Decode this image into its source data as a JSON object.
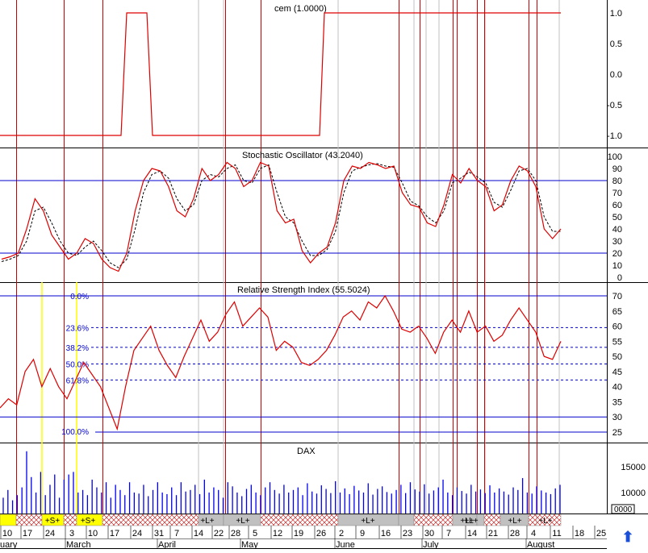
{
  "colors": {
    "price_line": "#dd0000",
    "signal_dashed": "#000000",
    "level_line": "#0000cc",
    "fib_line": "#0000cc",
    "event_vline": "#cc0000",
    "grid_vline": "#c0c0c0",
    "volume_bar": "#0000ee",
    "band_red": "#cc0000",
    "band_gray": "#c0c0c0",
    "band_yellow": "#ffff00",
    "arrow": "#1a4fd6"
  },
  "panels": {
    "cem": {
      "title": "cem (1.0000)",
      "y_ticks": [
        "1.0",
        "0.5",
        "0.0",
        "-0.5",
        "-1.0"
      ]
    },
    "stoch": {
      "title": "Stochastic Oscillator (43.2040)",
      "y_ticks": [
        "100",
        "90",
        "80",
        "70",
        "60",
        "50",
        "40",
        "30",
        "20",
        "10",
        "0"
      ]
    },
    "rsi": {
      "title": "Relative Strength Index (55.5024)",
      "y_ticks": [
        "70",
        "65",
        "60",
        "55",
        "50",
        "45",
        "40",
        "35",
        "30",
        "25"
      ],
      "fib_labels": [
        "0.0%",
        "23.6%",
        "38.2%",
        "50.0%",
        "61.8%",
        "100.0%"
      ]
    },
    "dax": {
      "title": "DAX",
      "y_ticks": [
        "15000",
        "10000"
      ],
      "mini_label": "0000"
    }
  },
  "band": {
    "labels": [
      "+S+",
      "+S+",
      "+L+",
      "+L+",
      "+L+",
      "+L+",
      "+L+",
      "+L+",
      "+L+"
    ]
  },
  "date_axis": {
    "day_labels": [
      "10",
      "17",
      "24",
      "3",
      "10",
      "17",
      "24",
      "31",
      "7",
      "14",
      "22",
      "28",
      "5",
      "12",
      "19",
      "26",
      "2",
      "9",
      "16",
      "23",
      "30",
      "7",
      "14",
      "21",
      "28",
      "4",
      "11",
      "18",
      "25"
    ],
    "month_labels": [
      "uary",
      "March",
      "April",
      "May",
      "June",
      "July",
      "August"
    ]
  },
  "chart_data": [
    {
      "type": "line",
      "title": "cem (1.0000)",
      "ylim": [
        -1.0,
        1.0
      ],
      "x": [
        0,
        1,
        2,
        3,
        4,
        5,
        6,
        7,
        8,
        9,
        10,
        11,
        12,
        13,
        14,
        15,
        16,
        17,
        18,
        19,
        20,
        21,
        22,
        23,
        24,
        25,
        26,
        27
      ],
      "series": [
        {
          "values": [
            -1,
            -1,
            -1,
            -1,
            -1,
            -1,
            -1,
            -1,
            1,
            1,
            -1,
            -1,
            -1,
            -1,
            -1,
            -1,
            -1,
            -1,
            -1,
            -1,
            -1,
            -1,
            1,
            1,
            1,
            1,
            1,
            1
          ]
        }
      ]
    },
    {
      "type": "line",
      "title": "Stochastic Oscillator (43.2040)",
      "ylim": [
        0,
        100
      ],
      "series": [
        {
          "values": [
            15,
            17,
            20,
            40,
            65,
            55,
            35,
            25,
            15,
            20,
            32,
            28,
            15,
            8,
            5,
            20,
            55,
            80,
            90,
            88,
            75,
            55,
            50,
            65,
            90,
            80,
            85,
            95,
            90,
            75,
            80,
            95,
            92,
            55,
            45,
            48,
            22,
            12,
            20,
            25,
            45,
            80,
            92,
            90,
            95,
            93,
            90,
            92,
            70,
            60,
            58,
            45,
            42,
            60,
            85,
            78,
            90,
            80,
            75,
            55,
            60,
            80,
            92,
            88,
            75,
            40,
            32,
            40
          ]
        },
        {
          "values": [
            13,
            15,
            18,
            30,
            55,
            58,
            45,
            30,
            20,
            18,
            25,
            30,
            22,
            12,
            8,
            15,
            40,
            70,
            85,
            88,
            82,
            65,
            55,
            60,
            80,
            85,
            83,
            90,
            93,
            80,
            78,
            90,
            93,
            70,
            50,
            45,
            30,
            18,
            18,
            23,
            38,
            70,
            88,
            91,
            93,
            94,
            92,
            91,
            78,
            63,
            59,
            50,
            45,
            55,
            78,
            82,
            87,
            83,
            78,
            62,
            58,
            72,
            88,
            90,
            80,
            50,
            38,
            38
          ]
        }
      ]
    },
    {
      "type": "line",
      "title": "Relative Strength Index (55.5024)",
      "ylim": [
        25,
        70
      ],
      "series": [
        {
          "values": [
            33,
            36,
            34,
            45,
            49,
            40,
            46,
            40,
            36,
            42,
            48,
            44,
            40,
            33,
            26,
            40,
            52,
            56,
            60,
            52,
            47,
            43,
            50,
            56,
            62,
            55,
            58,
            64,
            68,
            60,
            63,
            66,
            63,
            52,
            55,
            53,
            48,
            47,
            49,
            52,
            57,
            63,
            65,
            62,
            68,
            66,
            70,
            65,
            59,
            58,
            60,
            56,
            51,
            58,
            62,
            58,
            65,
            58,
            60,
            55,
            57,
            62,
            66,
            62,
            58,
            50,
            49,
            55
          ]
        }
      ],
      "levels": [
        70,
        30,
        25
      ],
      "fib_levels": [
        {
          "label": "0.0%",
          "value": 70
        },
        {
          "label": "23.6%",
          "value": 59.5
        },
        {
          "label": "38.2%",
          "value": 53
        },
        {
          "label": "50.0%",
          "value": 47.5
        },
        {
          "label": "61.8%",
          "value": 42.2
        },
        {
          "label": "100.0%",
          "value": 25.3
        }
      ]
    },
    {
      "type": "bar",
      "title": "DAX",
      "ylim": [
        7000,
        18000
      ],
      "values": [
        9000,
        10500,
        8500,
        9500,
        11000,
        18000,
        13000,
        10000,
        14000,
        9500,
        11500,
        13500,
        9000,
        12500,
        13500,
        14000,
        10000,
        10500,
        9500,
        12500,
        11000,
        10000,
        12000,
        9000,
        11500,
        10500,
        9500,
        12000,
        10000,
        9800,
        11500,
        9300,
        10500,
        12000,
        10000,
        9700,
        11000,
        9500,
        12000,
        10200,
        10500,
        11500,
        9700,
        12500,
        10000,
        11000,
        10500,
        9000,
        12000,
        11200,
        10000,
        9300,
        10700,
        11500,
        10000,
        9500,
        11000,
        12000,
        10500,
        9800,
        11500,
        10000,
        10500,
        11000,
        9500,
        11800,
        10200,
        9800,
        11400,
        10700,
        9900,
        12200,
        10000,
        10800,
        9700,
        11300,
        10400,
        10000,
        11800,
        9600,
        10700,
        11200,
        10100,
        9800,
        10500,
        11500,
        9900,
        12000,
        10600,
        10200,
        11600,
        9800,
        10400,
        11000,
        12500,
        10000,
        9500,
        11000,
        10300,
        9800,
        11500,
        10200,
        10600,
        9900,
        11400,
        10000,
        10800,
        10200,
        9600,
        11000,
        10500,
        12800,
        10000,
        9800,
        11200,
        10400,
        10000,
        9700,
        10800,
        11500
      ]
    }
  ]
}
